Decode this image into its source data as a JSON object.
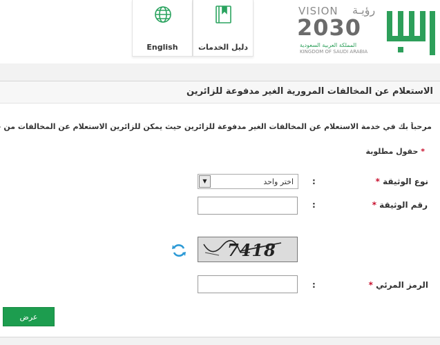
{
  "header": {
    "nav": [
      {
        "label": "English",
        "icon": "globe-icon"
      },
      {
        "label": "دليل الخدمات",
        "icon": "book-icon"
      }
    ],
    "vision": {
      "title": "VISION",
      "title_ar": "رؤيـة",
      "year": "2030",
      "subtitle_ar": "المملكة العربية السعودية",
      "subtitle_en": "KINGDOM OF SAUDI ARABIA"
    },
    "brand_color": "#2d9f5a"
  },
  "page": {
    "title": "الاستعلام عن المخالفات المرورية الغير مدفوعة للزائرين",
    "welcome": "مرحباً بك في خدمة الاستعلام عن المخالفات الغير مدفوعة للزائرين حيث يمكن للزائرين الاستعلام عن المخالفات من خلال",
    "required_note": "حقول مطلوبة"
  },
  "form": {
    "doc_type_label": "نوع الوثيقة",
    "doc_type_value": "اختر واحد",
    "doc_number_label": "رقم الوثيقة",
    "doc_number_value": "",
    "captcha_text": "7418",
    "captcha_label": "الرمز المرئي",
    "captcha_value": "",
    "colon": ":",
    "submit_label": "عرض",
    "required_mark": "*"
  }
}
